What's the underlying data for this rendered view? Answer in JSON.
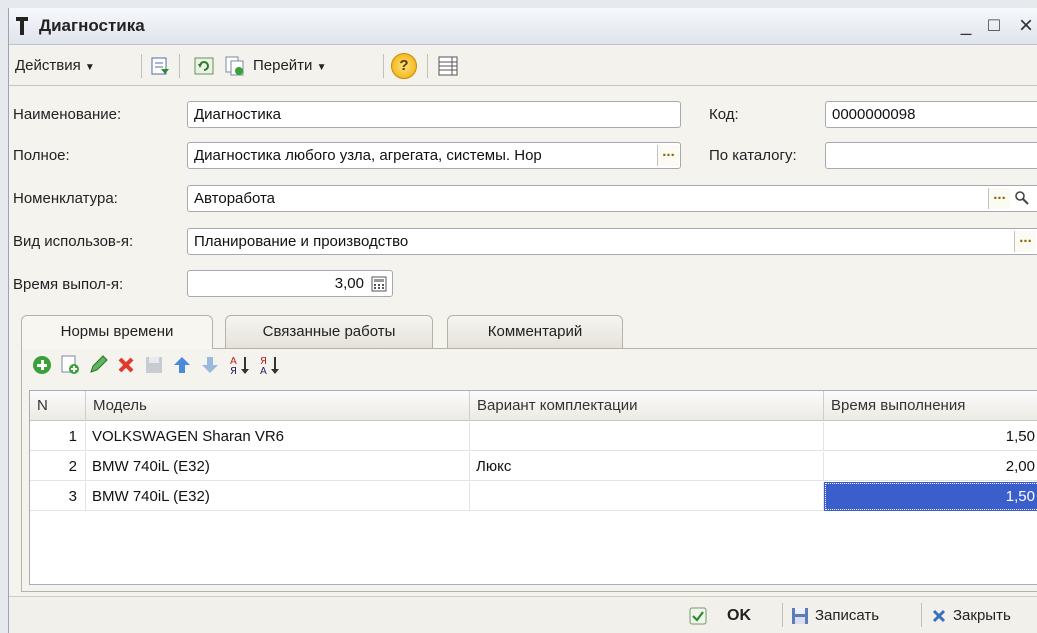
{
  "window": {
    "title": "Диагностика",
    "controls": {
      "minimize": "_",
      "maximize": "□",
      "close": "×"
    }
  },
  "toolbar": {
    "actions_label": "Действия",
    "goto_label": "Перейти",
    "help_label": "?"
  },
  "form": {
    "name_label": "Наименование:",
    "name_value": "Диагностика",
    "code_label": "Код:",
    "code_value": "0000000098",
    "full_label": "Полное:",
    "full_value": "Диагностика любого узла, агрегата, системы. Нор",
    "catalog_label": "По каталогу:",
    "catalog_value": "",
    "nomenclature_label": "Номенклатура:",
    "nomenclature_value": "Авторабота",
    "usage_label": "Вид использов-я:",
    "usage_value": "Планирование и производство",
    "time_label": "Время выпол-я:",
    "time_value": "3,00",
    "dots": "..."
  },
  "tabs": [
    {
      "label": "Нормы времени"
    },
    {
      "label": "Связанные работы"
    },
    {
      "label": "Комментарий"
    }
  ],
  "grid": {
    "columns": [
      "N",
      "Модель",
      "Вариант комплектации",
      "Время выполнения"
    ],
    "rows": [
      {
        "n": "1",
        "model": "VOLKSWAGEN Sharan VR6",
        "variant": "",
        "time": "1,50"
      },
      {
        "n": "2",
        "model": "BMW 740iL (E32)",
        "variant": "Люкс",
        "time": "2,00"
      },
      {
        "n": "3",
        "model": "BMW 740iL (E32)",
        "variant": "",
        "time": "1,50"
      }
    ]
  },
  "bottom": {
    "ok_label": "OK",
    "save_label": "Записать",
    "close_label": "Закрыть"
  },
  "colors": {
    "selection": "#3a5fcd",
    "window_bg": "#f4f3ee",
    "title_bg": "#dfe4ec"
  }
}
